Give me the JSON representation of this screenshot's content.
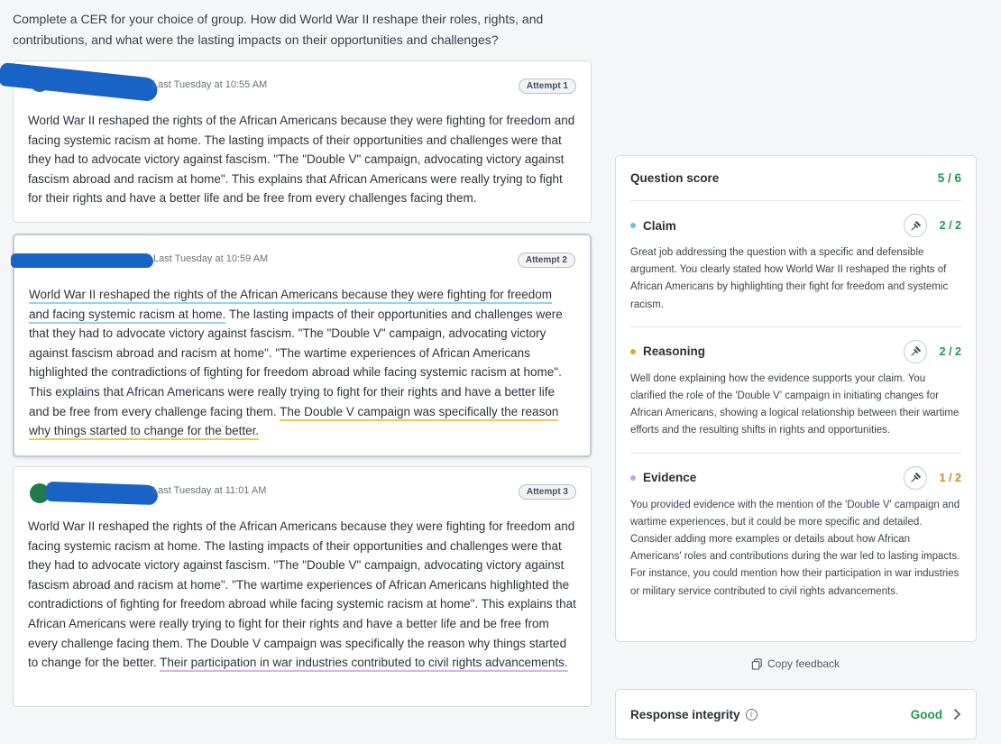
{
  "prompt": "Complete a CER for your choice of group. How did World War II reshape their roles, rights, and contributions, and what were the lasting impacts on their opportunities and challenges?",
  "attempts": [
    {
      "timestamp": "Last Tuesday at 10:55 AM",
      "badge": "Attempt 1",
      "text": "World War II reshaped the rights of the African Americans because they were fighting for freedom and facing systemic racism at home. The lasting impacts of their opportunities and challenges were that they had to advocate victory against fascism. \"The \"Double V\" campaign, advocating victory against fascism abroad and racism at home\". This explains that African Americans were really trying to fight for their rights and have a better life and be free from every challenges facing them."
    },
    {
      "timestamp": "Last Tuesday at 10:59 AM",
      "badge": "Attempt 2",
      "claim": "World War II reshaped the rights of the African Americans because they were fighting for freedom and facing systemic racism at home.",
      "middle": " The lasting impacts of their opportunities and challenges were that they had to advocate victory against fascism. \"The \"Double V\" campaign, advocating victory against fascism abroad and racism at home\". \"The wartime experiences of African Americans highlighted the contradictions of fighting for freedom abroad while facing systemic racism at home\". This explains that African Americans were really trying to fight for their rights and have a better life and be free from every challenge facing them. ",
      "reasoning": "The Double V campaign was specifically the reason why things started to change for the better."
    },
    {
      "timestamp": "Last Tuesday at 11:01 AM",
      "badge": "Attempt 3",
      "main": "World War II reshaped the rights of the African Americans because they were fighting for freedom and facing systemic racism at home. The lasting impacts of their opportunities and challenges were that they had to advocate victory against fascism. \"The \"Double V\" campaign, advocating victory against fascism abroad and racism at home\". \"The wartime experiences of African Americans highlighted the contradictions of fighting for freedom abroad while facing systemic racism at home\". This explains that African Americans were really trying to fight for their rights and have a better life and be free from every challenge facing them. The Double V campaign was specifically the reason why things started to change for the better. ",
      "evidence": "Their participation in war industries contributed to civil rights advancements."
    }
  ],
  "score": {
    "label": "Question score",
    "value": "5 / 6",
    "criteria": [
      {
        "name": "Claim",
        "score": "2 / 2",
        "dot_color": "#5bc6dd",
        "feedback": "Great job addressing the question with a specific and defensible argument. You clearly stated how World War II reshaped the rights of African Americans by highlighting their fight for freedom and systemic racism."
      },
      {
        "name": "Reasoning",
        "score": "2 / 2",
        "dot_color": "#e0a82e",
        "feedback": "Well done explaining how the evidence supports your claim. You clarified the role of the 'Double V' campaign in initiating changes for African Americans, showing a logical relationship between their wartime efforts and the resulting shifts in rights and opportunities."
      },
      {
        "name": "Evidence",
        "score": "1 / 2",
        "dot_color": "#c9a0e6",
        "feedback": "You provided evidence with the mention of the 'Double V' campaign and wartime experiences, but it could be more specific and detailed. Consider adding more examples or details about how African Americans' roles and contributions during the war led to lasting impacts. For instance, you could mention how their participation in war industries or military service contributed to civil rights advancements."
      }
    ]
  },
  "copy_feedback": "Copy feedback",
  "integrity": {
    "label": "Response integrity",
    "info_glyph": "i",
    "status": "Good"
  },
  "colors": {
    "good": "#1f9a4f",
    "partial": "#d9822b",
    "claim_underline": "#8fd7e6",
    "reasoning_underline": "#e8c862",
    "evidence_underline": "#d9b3ee",
    "redaction": "#1a63c6"
  }
}
